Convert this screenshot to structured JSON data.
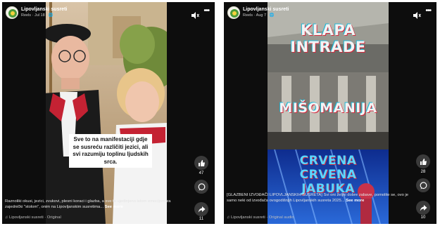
{
  "reel1": {
    "page_name": "Lipovljanski susreti",
    "meta": "Reels · Jul 18 · 🌐",
    "overlay_text": "Sve to na manifestaciji gdje se susreću različiti jezici, ali svi razumiju toplinu ljudskih srca.",
    "caption": "Raznoliki okusi, jezici, zvukovi, plesni koraci i glazba, a sve to ujedinjeno istom emocijom za zajednički \"stolom\", onim na Lipovljanskim susretima...",
    "see_more": "See more",
    "audio": "Lipovljanski susreti · Original",
    "like_count": "47",
    "share_count": "11"
  },
  "reel2": {
    "page_name": "Lipovljanski susreti",
    "meta": "Reels · Aug 7 · 🌐",
    "title1_line1": "KLAPA",
    "title1_line2": "INTRADE",
    "title2": "MIŠOMANIJA",
    "title3_line1": "CRVENA",
    "title3_line2": "CRVENA",
    "title3_line3": "JABUKA",
    "caption": "[GLAZBENI IZVOĐAČI LIPOVLJANSKIH SUSRETA] Svi oni željni dobre zabave, pomolite se, ovo je samo neki od izvođača ovogodišnjih Lipovljanskih susreta 2025...",
    "see_more": "See more",
    "audio": "Lipovljanski susreti · Original audio",
    "like_count": "28",
    "share_count": "10"
  },
  "colors": {
    "reel_bg": "#0d0d0d",
    "overlay_red": "#d42a3e",
    "overlay_cyan": "#1fb7d6"
  },
  "icons": [
    "avatar-logo",
    "volume-icon",
    "more-icon",
    "like-icon",
    "comment-icon",
    "share-icon",
    "music-icon"
  ]
}
